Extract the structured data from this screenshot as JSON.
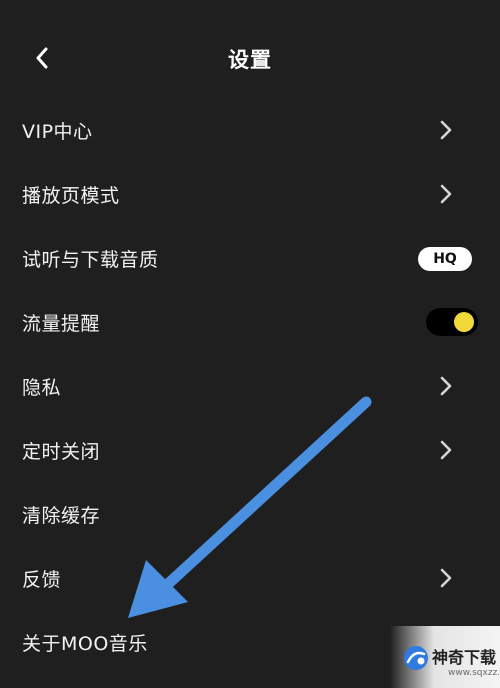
{
  "header": {
    "title": "设置",
    "back_icon": "chevron-left-icon"
  },
  "settings": {
    "items": [
      {
        "label": "VIP中心",
        "control": "chevron-right-icon"
      },
      {
        "label": "播放页模式",
        "control": "chevron-right-icon"
      },
      {
        "label": "试听与下载音质",
        "control": "badge",
        "badge": "HQ"
      },
      {
        "label": "流量提醒",
        "control": "toggle",
        "toggle_on": true
      },
      {
        "label": "隐私",
        "control": "chevron-right-icon"
      },
      {
        "label": "定时关闭",
        "control": "chevron-right-icon"
      },
      {
        "label": "清除缓存",
        "control": "none"
      },
      {
        "label": "反馈",
        "control": "chevron-right-icon"
      },
      {
        "label": "关于MOO音乐",
        "control": "none"
      }
    ]
  },
  "watermark": {
    "name": "神奇下载",
    "url": "www.sqxzz.com"
  },
  "colors": {
    "background": "#1f1f1f",
    "toggle_knob": "#f3d83c",
    "arrow": "#4a8fe0"
  }
}
